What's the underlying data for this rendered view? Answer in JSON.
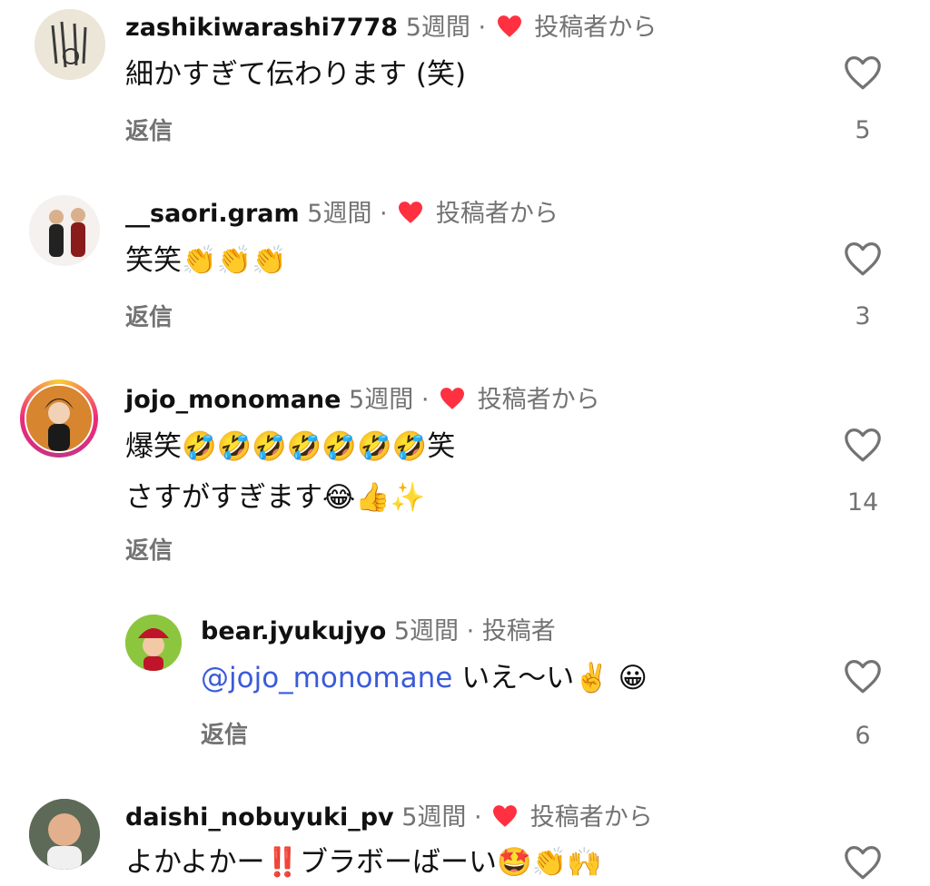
{
  "comments": [
    {
      "username": "zashikiwarashi7778",
      "time": "5週間",
      "separator": "·",
      "by_author": "投稿者から",
      "text": "細かすぎて伝わります (笑)",
      "reply_label": "返信",
      "likes": "5"
    },
    {
      "username": "__saori.gram",
      "time": "5週間",
      "separator": "·",
      "by_author": "投稿者から",
      "text": "笑笑👏👏👏",
      "reply_label": "返信",
      "likes": "3"
    },
    {
      "username": "jojo_monomane",
      "time": "5週間",
      "separator": "·",
      "by_author": "投稿者から",
      "text_line1": "爆笑🤣🤣🤣🤣🤣🤣🤣笑",
      "text_line2": "さすがすぎます😂👍✨",
      "reply_label": "返信",
      "likes": "14"
    },
    {
      "username": "bear.jyukujyo",
      "time": "5週間",
      "separator": "·",
      "author_tag": "投稿者",
      "mention": "@jojo_monomane",
      "text": " いえ〜い✌️ 😀",
      "reply_label": "返信",
      "likes": "6"
    },
    {
      "username": "daishi_nobuyuki_pv",
      "time": "5週間",
      "separator": "·",
      "by_author": "投稿者から",
      "text": "よかよかー‼️ブラボーばーい🤩👏🙌"
    }
  ],
  "colors": {
    "heart_red": "#ff3040",
    "secondary_text": "#737373",
    "mention_blue": "#3a5bd9"
  },
  "icons": {
    "like": "heart-outline-icon",
    "author_liked": "heart-filled-icon"
  }
}
